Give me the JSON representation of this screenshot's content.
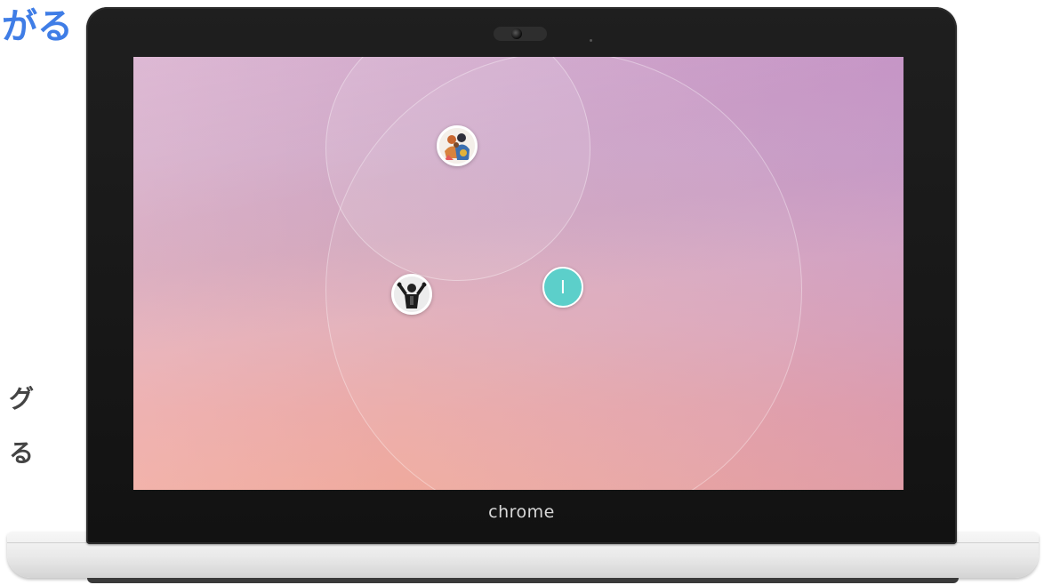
{
  "side_text": {
    "heading": "がる",
    "line1": "グ",
    "line2": "る"
  },
  "laptop": {
    "bezel_logo": "chrome"
  },
  "screen": {
    "user_marker": {
      "initial": "I",
      "color": "#5ccfca"
    },
    "avatars": [
      {
        "icon": "group-photo-avatar-icon"
      },
      {
        "icon": "performer-photo-avatar-icon"
      }
    ]
  }
}
